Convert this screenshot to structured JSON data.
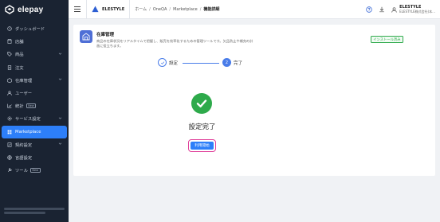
{
  "brand": {
    "name": "elepay"
  },
  "sidebar": {
    "items": [
      {
        "label": "ダッシュボード",
        "icon": "clock-icon",
        "chevron": false,
        "new": false,
        "active": false
      },
      {
        "label": "店舗",
        "icon": "store-icon",
        "chevron": false,
        "new": false,
        "active": false
      },
      {
        "label": "商品",
        "icon": "tag-icon",
        "chevron": true,
        "new": false,
        "active": false
      },
      {
        "label": "注文",
        "icon": "document-icon",
        "chevron": false,
        "new": false,
        "active": false
      },
      {
        "label": "在庫管理",
        "icon": "box-icon",
        "chevron": true,
        "new": false,
        "active": false
      },
      {
        "label": "ユーザー",
        "icon": "user-icon",
        "chevron": false,
        "new": false,
        "active": false
      },
      {
        "label": "統計",
        "icon": "chart-icon",
        "chevron": false,
        "new": true,
        "new_label": "New",
        "active": false
      },
      {
        "label": "サービス設定",
        "icon": "settings-icon",
        "chevron": true,
        "new": false,
        "active": false
      },
      {
        "label": "Marketplace",
        "icon": "grid-icon",
        "chevron": false,
        "new": false,
        "active": true
      },
      {
        "label": "契約設定",
        "icon": "contract-icon",
        "chevron": true,
        "new": false,
        "active": false
      },
      {
        "label": "言語設定",
        "icon": "language-icon",
        "chevron": false,
        "new": false,
        "active": false
      },
      {
        "label": "ツール",
        "icon": "wrench-icon",
        "chevron": false,
        "new": true,
        "new_label": "New",
        "active": false
      }
    ]
  },
  "header": {
    "store_name": "ELESTYLE",
    "breadcrumb": [
      "ホーム",
      "OneQA",
      "Marketplace",
      "機能詳細"
    ],
    "user_name": "ELESTYLE",
    "user_org": "ELESTYLE株式会社(本..."
  },
  "app": {
    "title": "在庫管理",
    "description": "商品の在庫状況をリアルタイムで把握し、販売を効率化するための管理ツールです。欠品防止や補充の計画に役立ちます。",
    "installed_badge": "インストール済み"
  },
  "stepper": {
    "steps": [
      {
        "label": "設定",
        "status": "done"
      },
      {
        "label": "完了",
        "number": "2",
        "status": "current"
      }
    ]
  },
  "result": {
    "title": "設定完了",
    "button_label": "利用開始"
  },
  "colors": {
    "sidebar_bg": "#1a2332",
    "accent": "#2d7ff9",
    "success": "#2eaa4b",
    "highlight": "#e0409a"
  }
}
